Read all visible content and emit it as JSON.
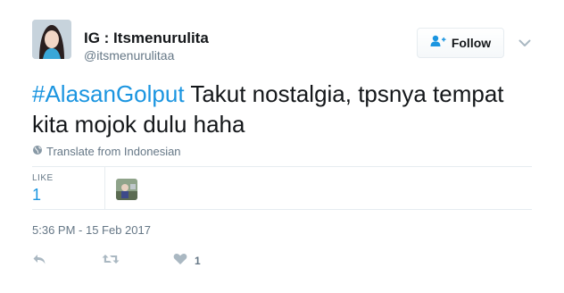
{
  "tweet": {
    "display_name": "IG : Itsmenurulita",
    "handle": "@itsmenurulitaa",
    "follow_label": "Follow",
    "hashtag": "#AlasanGolput",
    "text": " Takut nostalgia, tpsnya tempat kita mojok dulu haha",
    "translate_label": "Translate from Indonesian",
    "stats": {
      "label": "LIKE",
      "value": "1"
    },
    "timestamp": "5:36 PM - 15 Feb 2017",
    "actions": {
      "like_count": "1"
    }
  },
  "icons": {
    "follow": "person-plus-icon",
    "caret": "chevron-down-icon",
    "translate": "globe-icon",
    "reply": "reply-icon",
    "retweet": "retweet-icon",
    "like": "heart-icon"
  },
  "colors": {
    "link": "#1b95e0",
    "text": "#14171a",
    "muted": "#657786",
    "icon": "#aab8c2",
    "border": "#e6ecf0"
  }
}
